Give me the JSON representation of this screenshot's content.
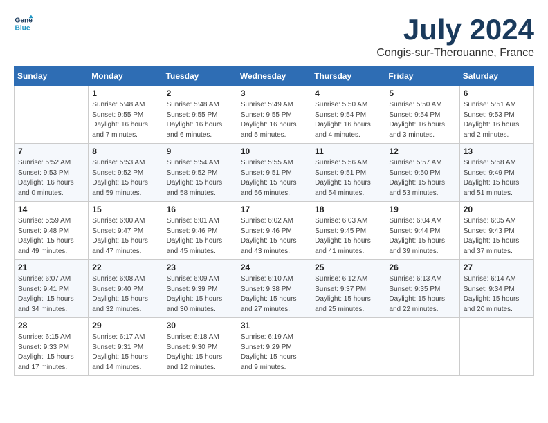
{
  "header": {
    "logo_line1": "General",
    "logo_line2": "Blue",
    "month_year": "July 2024",
    "location": "Congis-sur-Therouanne, France"
  },
  "days_of_week": [
    "Sunday",
    "Monday",
    "Tuesday",
    "Wednesday",
    "Thursday",
    "Friday",
    "Saturday"
  ],
  "weeks": [
    [
      {
        "day": "",
        "info": ""
      },
      {
        "day": "1",
        "info": "Sunrise: 5:48 AM\nSunset: 9:55 PM\nDaylight: 16 hours\nand 7 minutes."
      },
      {
        "day": "2",
        "info": "Sunrise: 5:48 AM\nSunset: 9:55 PM\nDaylight: 16 hours\nand 6 minutes."
      },
      {
        "day": "3",
        "info": "Sunrise: 5:49 AM\nSunset: 9:55 PM\nDaylight: 16 hours\nand 5 minutes."
      },
      {
        "day": "4",
        "info": "Sunrise: 5:50 AM\nSunset: 9:54 PM\nDaylight: 16 hours\nand 4 minutes."
      },
      {
        "day": "5",
        "info": "Sunrise: 5:50 AM\nSunset: 9:54 PM\nDaylight: 16 hours\nand 3 minutes."
      },
      {
        "day": "6",
        "info": "Sunrise: 5:51 AM\nSunset: 9:53 PM\nDaylight: 16 hours\nand 2 minutes."
      }
    ],
    [
      {
        "day": "7",
        "info": "Sunrise: 5:52 AM\nSunset: 9:53 PM\nDaylight: 16 hours\nand 0 minutes."
      },
      {
        "day": "8",
        "info": "Sunrise: 5:53 AM\nSunset: 9:52 PM\nDaylight: 15 hours\nand 59 minutes."
      },
      {
        "day": "9",
        "info": "Sunrise: 5:54 AM\nSunset: 9:52 PM\nDaylight: 15 hours\nand 58 minutes."
      },
      {
        "day": "10",
        "info": "Sunrise: 5:55 AM\nSunset: 9:51 PM\nDaylight: 15 hours\nand 56 minutes."
      },
      {
        "day": "11",
        "info": "Sunrise: 5:56 AM\nSunset: 9:51 PM\nDaylight: 15 hours\nand 54 minutes."
      },
      {
        "day": "12",
        "info": "Sunrise: 5:57 AM\nSunset: 9:50 PM\nDaylight: 15 hours\nand 53 minutes."
      },
      {
        "day": "13",
        "info": "Sunrise: 5:58 AM\nSunset: 9:49 PM\nDaylight: 15 hours\nand 51 minutes."
      }
    ],
    [
      {
        "day": "14",
        "info": "Sunrise: 5:59 AM\nSunset: 9:48 PM\nDaylight: 15 hours\nand 49 minutes."
      },
      {
        "day": "15",
        "info": "Sunrise: 6:00 AM\nSunset: 9:47 PM\nDaylight: 15 hours\nand 47 minutes."
      },
      {
        "day": "16",
        "info": "Sunrise: 6:01 AM\nSunset: 9:46 PM\nDaylight: 15 hours\nand 45 minutes."
      },
      {
        "day": "17",
        "info": "Sunrise: 6:02 AM\nSunset: 9:46 PM\nDaylight: 15 hours\nand 43 minutes."
      },
      {
        "day": "18",
        "info": "Sunrise: 6:03 AM\nSunset: 9:45 PM\nDaylight: 15 hours\nand 41 minutes."
      },
      {
        "day": "19",
        "info": "Sunrise: 6:04 AM\nSunset: 9:44 PM\nDaylight: 15 hours\nand 39 minutes."
      },
      {
        "day": "20",
        "info": "Sunrise: 6:05 AM\nSunset: 9:43 PM\nDaylight: 15 hours\nand 37 minutes."
      }
    ],
    [
      {
        "day": "21",
        "info": "Sunrise: 6:07 AM\nSunset: 9:41 PM\nDaylight: 15 hours\nand 34 minutes."
      },
      {
        "day": "22",
        "info": "Sunrise: 6:08 AM\nSunset: 9:40 PM\nDaylight: 15 hours\nand 32 minutes."
      },
      {
        "day": "23",
        "info": "Sunrise: 6:09 AM\nSunset: 9:39 PM\nDaylight: 15 hours\nand 30 minutes."
      },
      {
        "day": "24",
        "info": "Sunrise: 6:10 AM\nSunset: 9:38 PM\nDaylight: 15 hours\nand 27 minutes."
      },
      {
        "day": "25",
        "info": "Sunrise: 6:12 AM\nSunset: 9:37 PM\nDaylight: 15 hours\nand 25 minutes."
      },
      {
        "day": "26",
        "info": "Sunrise: 6:13 AM\nSunset: 9:35 PM\nDaylight: 15 hours\nand 22 minutes."
      },
      {
        "day": "27",
        "info": "Sunrise: 6:14 AM\nSunset: 9:34 PM\nDaylight: 15 hours\nand 20 minutes."
      }
    ],
    [
      {
        "day": "28",
        "info": "Sunrise: 6:15 AM\nSunset: 9:33 PM\nDaylight: 15 hours\nand 17 minutes."
      },
      {
        "day": "29",
        "info": "Sunrise: 6:17 AM\nSunset: 9:31 PM\nDaylight: 15 hours\nand 14 minutes."
      },
      {
        "day": "30",
        "info": "Sunrise: 6:18 AM\nSunset: 9:30 PM\nDaylight: 15 hours\nand 12 minutes."
      },
      {
        "day": "31",
        "info": "Sunrise: 6:19 AM\nSunset: 9:29 PM\nDaylight: 15 hours\nand 9 minutes."
      },
      {
        "day": "",
        "info": ""
      },
      {
        "day": "",
        "info": ""
      },
      {
        "day": "",
        "info": ""
      }
    ]
  ]
}
